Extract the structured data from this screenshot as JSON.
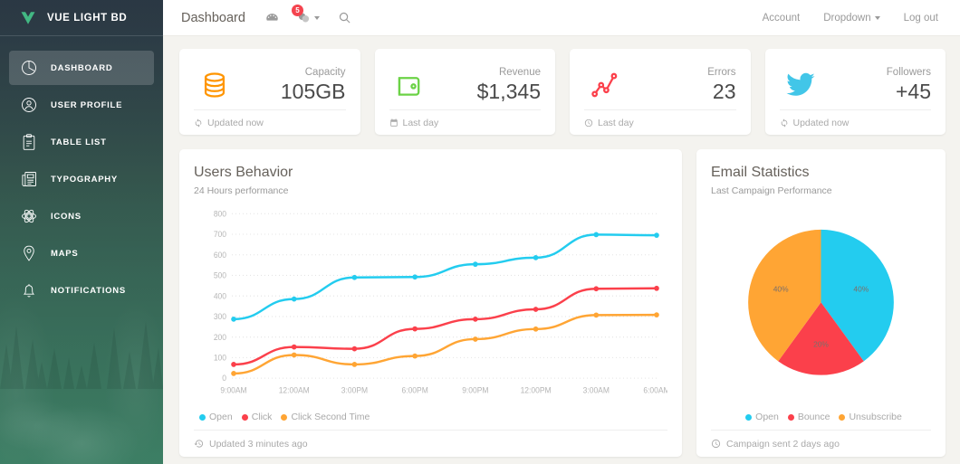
{
  "sidebar": {
    "brand": "VUE LIGHT BD",
    "items": [
      {
        "label": "DASHBOARD",
        "icon": "pie-chart-icon",
        "active": true
      },
      {
        "label": "USER PROFILE",
        "icon": "user-icon",
        "active": false
      },
      {
        "label": "TABLE LIST",
        "icon": "clipboard-icon",
        "active": false
      },
      {
        "label": "TYPOGRAPHY",
        "icon": "newspaper-icon",
        "active": false
      },
      {
        "label": "ICONS",
        "icon": "atom-icon",
        "active": false
      },
      {
        "label": "MAPS",
        "icon": "map-pin-icon",
        "active": false
      },
      {
        "label": "NOTIFICATIONS",
        "icon": "bell-icon",
        "active": false
      }
    ]
  },
  "navbar": {
    "title": "Dashboard",
    "dashboard_icon": "speedometer-icon",
    "notification_icon": "notification-icon",
    "notification_badge": "5",
    "search_icon": "search-icon",
    "links": [
      {
        "label": "Account",
        "caret": false
      },
      {
        "label": "Dropdown",
        "caret": true
      },
      {
        "label": "Log out",
        "caret": false
      }
    ]
  },
  "stats": [
    {
      "label": "Capacity",
      "value": "105GB",
      "icon": "database-icon",
      "icon_color": "#FF9500",
      "foot": "Updated now",
      "foot_icon": "refresh-icon"
    },
    {
      "label": "Revenue",
      "value": "$1,345",
      "icon": "wallet-icon",
      "icon_color": "#6BD246",
      "foot": "Last day",
      "foot_icon": "calendar-icon"
    },
    {
      "label": "Errors",
      "value": "23",
      "icon": "line-graph-icon",
      "icon_color": "#FB404B",
      "foot": "Last day",
      "foot_icon": "clock-icon"
    },
    {
      "label": "Followers",
      "value": "+45",
      "icon": "twitter-icon",
      "icon_color": "#42C6E8",
      "foot": "Updated now",
      "foot_icon": "refresh-icon"
    }
  ],
  "users_behavior": {
    "title": "Users Behavior",
    "subtitle": "24 Hours performance",
    "legend": [
      {
        "label": "Open",
        "color": "#23CCEF"
      },
      {
        "label": "Click",
        "color": "#FB404B"
      },
      {
        "label": "Click Second Time",
        "color": "#FFA534"
      }
    ],
    "footer": "Updated 3 minutes ago",
    "footer_icon": "history-icon"
  },
  "email_statistics": {
    "title": "Email Statistics",
    "subtitle": "Last Campaign Performance",
    "legend": [
      {
        "label": "Open",
        "color": "#23CCEF"
      },
      {
        "label": "Bounce",
        "color": "#FB404B"
      },
      {
        "label": "Unsubscribe",
        "color": "#FFA534"
      }
    ],
    "footer": "Campaign sent 2 days ago",
    "footer_icon": "clock-icon"
  },
  "chart_data": [
    {
      "type": "line",
      "title": "Users Behavior",
      "subtitle": "24 Hours performance",
      "xlabel": "",
      "ylabel": "",
      "categories": [
        "9:00AM",
        "12:00AM",
        "3:00PM",
        "6:00PM",
        "9:00PM",
        "12:00PM",
        "3:00AM",
        "6:00AM"
      ],
      "ylim": [
        0,
        800
      ],
      "yticks": [
        0,
        100,
        200,
        300,
        400,
        500,
        600,
        700,
        800
      ],
      "grid": true,
      "legend_position": "bottom-left",
      "series": [
        {
          "name": "Open",
          "color": "#23CCEF",
          "values": [
            287,
            385,
            490,
            492,
            554,
            586,
            698,
            695
          ]
        },
        {
          "name": "Click",
          "color": "#FB404B",
          "values": [
            67,
            152,
            143,
            240,
            287,
            335,
            435,
            437
          ]
        },
        {
          "name": "Click Second Time",
          "color": "#FFA534",
          "values": [
            23,
            113,
            67,
            108,
            190,
            239,
            307,
            308
          ]
        }
      ]
    },
    {
      "type": "pie",
      "title": "Email Statistics",
      "subtitle": "Last Campaign Performance",
      "labels": [
        "Open",
        "Bounce",
        "Unsubscribe"
      ],
      "values": [
        40,
        20,
        40
      ],
      "display_labels": [
        "40%",
        "20%",
        "40%"
      ],
      "colors": [
        "#23CCEF",
        "#FB404B",
        "#FFA534"
      ],
      "legend_position": "bottom-center"
    }
  ]
}
